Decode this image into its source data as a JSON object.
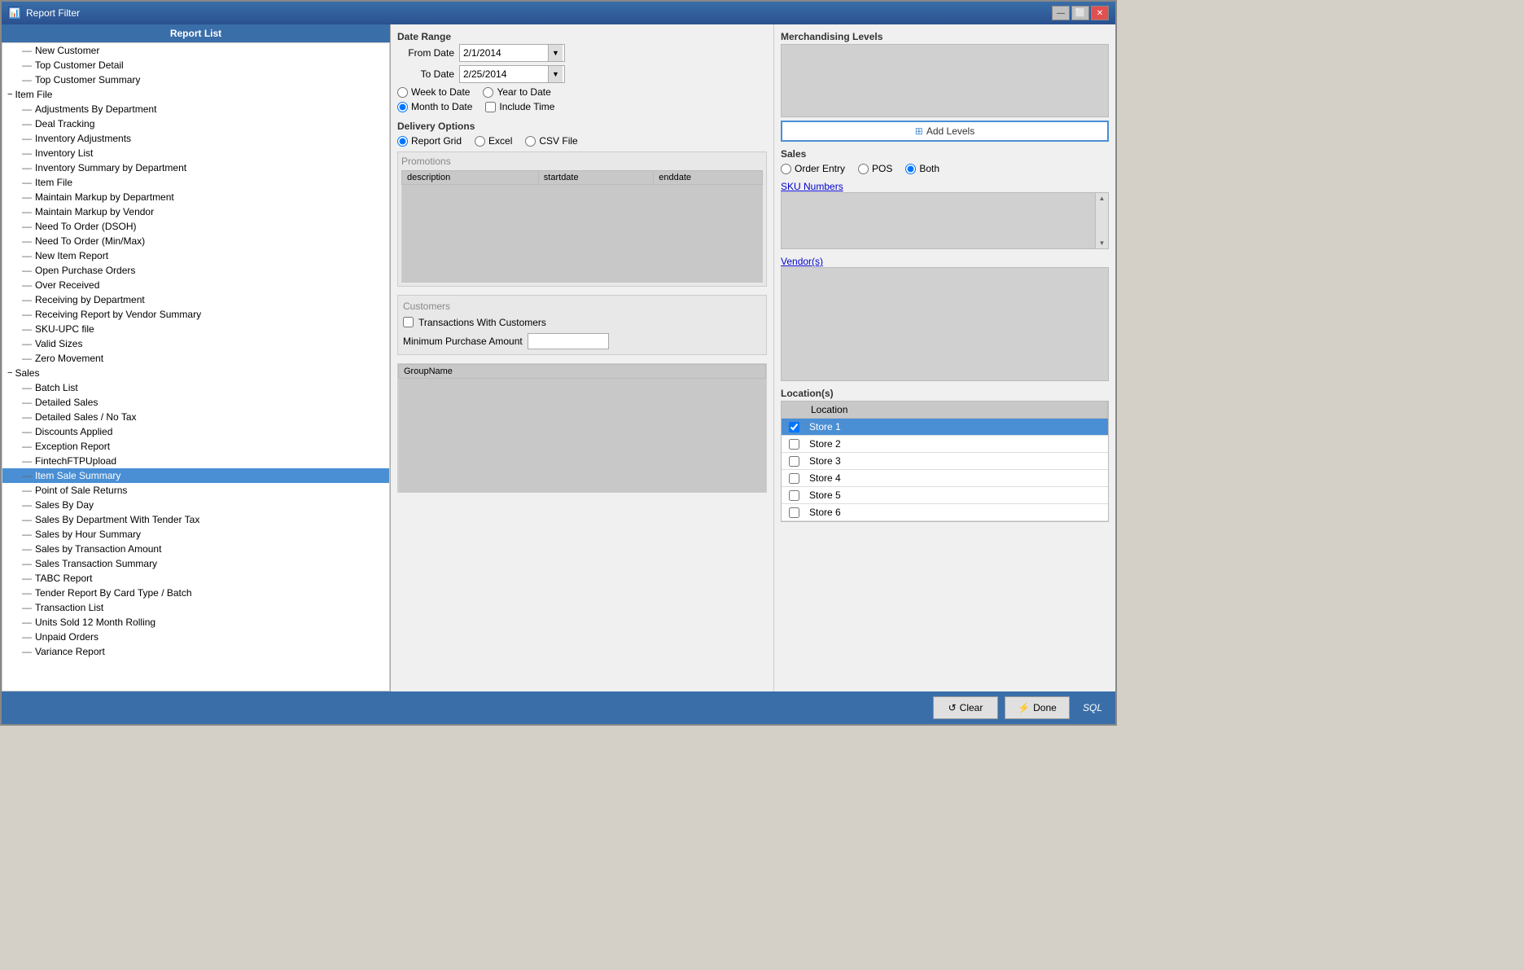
{
  "window": {
    "title": "Report Filter",
    "icon": "📊"
  },
  "titlebar": {
    "minimize_label": "—",
    "restore_label": "⬜",
    "close_label": "✕"
  },
  "report_list": {
    "header": "Report List",
    "items": [
      {
        "id": "new-customer",
        "label": "New Customer",
        "level": 1,
        "type": "leaf",
        "selected": false
      },
      {
        "id": "top-customer-detail",
        "label": "Top Customer Detail",
        "level": 1,
        "type": "leaf",
        "selected": false
      },
      {
        "id": "top-customer-summary",
        "label": "Top Customer Summary",
        "level": 1,
        "type": "leaf",
        "selected": false
      },
      {
        "id": "item-file",
        "label": "Item File",
        "level": 0,
        "type": "group",
        "selected": false
      },
      {
        "id": "adjustments-by-dept",
        "label": "Adjustments By Department",
        "level": 1,
        "type": "leaf",
        "selected": false
      },
      {
        "id": "deal-tracking",
        "label": "Deal Tracking",
        "level": 1,
        "type": "leaf",
        "selected": false
      },
      {
        "id": "inventory-adjustments",
        "label": "Inventory Adjustments",
        "level": 1,
        "type": "leaf",
        "selected": false
      },
      {
        "id": "inventory-list",
        "label": "Inventory List",
        "level": 1,
        "type": "leaf",
        "selected": false
      },
      {
        "id": "inventory-summary-by-dept",
        "label": "Inventory Summary by Department",
        "level": 1,
        "type": "leaf",
        "selected": false
      },
      {
        "id": "item-file-leaf",
        "label": "Item File",
        "level": 1,
        "type": "leaf",
        "selected": false
      },
      {
        "id": "maintain-markup-by-dept",
        "label": "Maintain Markup by Department",
        "level": 1,
        "type": "leaf",
        "selected": false
      },
      {
        "id": "maintain-markup-by-vendor",
        "label": "Maintain Markup by Vendor",
        "level": 1,
        "type": "leaf",
        "selected": false
      },
      {
        "id": "need-to-order-dsoh",
        "label": "Need To Order (DSOH)",
        "level": 1,
        "type": "leaf",
        "selected": false
      },
      {
        "id": "need-to-order-minmax",
        "label": "Need To Order (Min/Max)",
        "level": 1,
        "type": "leaf",
        "selected": false
      },
      {
        "id": "new-item-report",
        "label": "New Item Report",
        "level": 1,
        "type": "leaf",
        "selected": false
      },
      {
        "id": "open-purchase-orders",
        "label": "Open Purchase Orders",
        "level": 1,
        "type": "leaf",
        "selected": false
      },
      {
        "id": "over-received",
        "label": "Over Received",
        "level": 1,
        "type": "leaf",
        "selected": false
      },
      {
        "id": "receiving-by-dept",
        "label": "Receiving by Department",
        "level": 1,
        "type": "leaf",
        "selected": false
      },
      {
        "id": "receiving-report-vendor-summary",
        "label": "Receiving Report by Vendor Summary",
        "level": 1,
        "type": "leaf",
        "selected": false
      },
      {
        "id": "sku-upc-file",
        "label": "SKU-UPC file",
        "level": 1,
        "type": "leaf",
        "selected": false
      },
      {
        "id": "valid-sizes",
        "label": "Valid Sizes",
        "level": 1,
        "type": "leaf",
        "selected": false
      },
      {
        "id": "zero-movement",
        "label": "Zero Movement",
        "level": 1,
        "type": "leaf",
        "selected": false
      },
      {
        "id": "sales",
        "label": "Sales",
        "level": 0,
        "type": "group",
        "selected": false
      },
      {
        "id": "batch-list",
        "label": "Batch List",
        "level": 1,
        "type": "leaf",
        "selected": false
      },
      {
        "id": "detailed-sales",
        "label": "Detailed Sales",
        "level": 1,
        "type": "leaf",
        "selected": false
      },
      {
        "id": "detailed-sales-no-tax",
        "label": "Detailed Sales / No Tax",
        "level": 1,
        "type": "leaf",
        "selected": false
      },
      {
        "id": "discounts-applied",
        "label": "Discounts Applied",
        "level": 1,
        "type": "leaf",
        "selected": false
      },
      {
        "id": "exception-report",
        "label": "Exception Report",
        "level": 1,
        "type": "leaf",
        "selected": false
      },
      {
        "id": "fintech-ftp-upload",
        "label": "FintechFTPUpload",
        "level": 1,
        "type": "leaf",
        "selected": false
      },
      {
        "id": "item-sale-summary",
        "label": "Item Sale Summary",
        "level": 1,
        "type": "leaf",
        "selected": true
      },
      {
        "id": "point-of-sale-returns",
        "label": "Point of Sale Returns",
        "level": 1,
        "type": "leaf",
        "selected": false
      },
      {
        "id": "sales-by-day",
        "label": "Sales By Day",
        "level": 1,
        "type": "leaf",
        "selected": false
      },
      {
        "id": "sales-by-dept-tender-tax",
        "label": "Sales By Department With Tender Tax",
        "level": 1,
        "type": "leaf",
        "selected": false
      },
      {
        "id": "sales-by-hour-summary",
        "label": "Sales by Hour Summary",
        "level": 1,
        "type": "leaf",
        "selected": false
      },
      {
        "id": "sales-by-transaction-amount",
        "label": "Sales by Transaction Amount",
        "level": 1,
        "type": "leaf",
        "selected": false
      },
      {
        "id": "sales-transaction-summary",
        "label": "Sales Transaction Summary",
        "level": 1,
        "type": "leaf",
        "selected": false
      },
      {
        "id": "tabc-report",
        "label": "TABC Report",
        "level": 1,
        "type": "leaf",
        "selected": false
      },
      {
        "id": "tender-report-card-type",
        "label": "Tender Report By Card Type / Batch",
        "level": 1,
        "type": "leaf",
        "selected": false
      },
      {
        "id": "transaction-list",
        "label": "Transaction List",
        "level": 1,
        "type": "leaf",
        "selected": false
      },
      {
        "id": "units-sold-12-month",
        "label": "Units Sold 12 Month Rolling",
        "level": 1,
        "type": "leaf",
        "selected": false
      },
      {
        "id": "unpaid-orders",
        "label": "Unpaid Orders",
        "level": 1,
        "type": "leaf",
        "selected": false
      },
      {
        "id": "variance-report",
        "label": "Variance Report",
        "level": 1,
        "type": "leaf",
        "selected": false
      }
    ]
  },
  "date_range": {
    "label": "Date Range",
    "from_label": "From Date",
    "to_label": "To Date",
    "from_value": "2/1/2014",
    "to_value": "2/25/2014",
    "week_to_date_label": "Week to Date",
    "month_to_date_label": "Month to Date",
    "year_to_date_label": "Year to Date",
    "include_time_label": "Include Time"
  },
  "delivery_options": {
    "label": "Delivery Options",
    "report_grid_label": "Report Grid",
    "excel_label": "Excel",
    "csv_label": "CSV File"
  },
  "promotions": {
    "label": "Promotions",
    "cols": [
      "description",
      "startdate",
      "enddate"
    ]
  },
  "customers": {
    "label": "Customers",
    "transactions_label": "Transactions With Customers",
    "min_purchase_label": "Minimum Purchase Amount"
  },
  "group_name": {
    "col": "GroupName"
  },
  "right_panel": {
    "merch_levels_label": "Merchandising Levels",
    "add_levels_label": "Add Levels",
    "sales_label": "Sales",
    "order_entry_label": "Order Entry",
    "pos_label": "POS",
    "both_label": "Both",
    "sku_numbers_label": "SKU Numbers",
    "vendors_label": "Vendor(s)",
    "locations_label": "Location(s)",
    "location_col": "Location",
    "stores": [
      {
        "id": "store1",
        "name": "Store 1",
        "selected": true
      },
      {
        "id": "store2",
        "name": "Store 2",
        "selected": false
      },
      {
        "id": "store3",
        "name": "Store 3",
        "selected": false
      },
      {
        "id": "store4",
        "name": "Store 4",
        "selected": false
      },
      {
        "id": "store5",
        "name": "Store 5",
        "selected": false
      },
      {
        "id": "store6",
        "name": "Store 6",
        "selected": false
      }
    ]
  },
  "bottom_bar": {
    "clear_label": "Clear",
    "done_label": "Done",
    "sql_label": "SQL"
  }
}
